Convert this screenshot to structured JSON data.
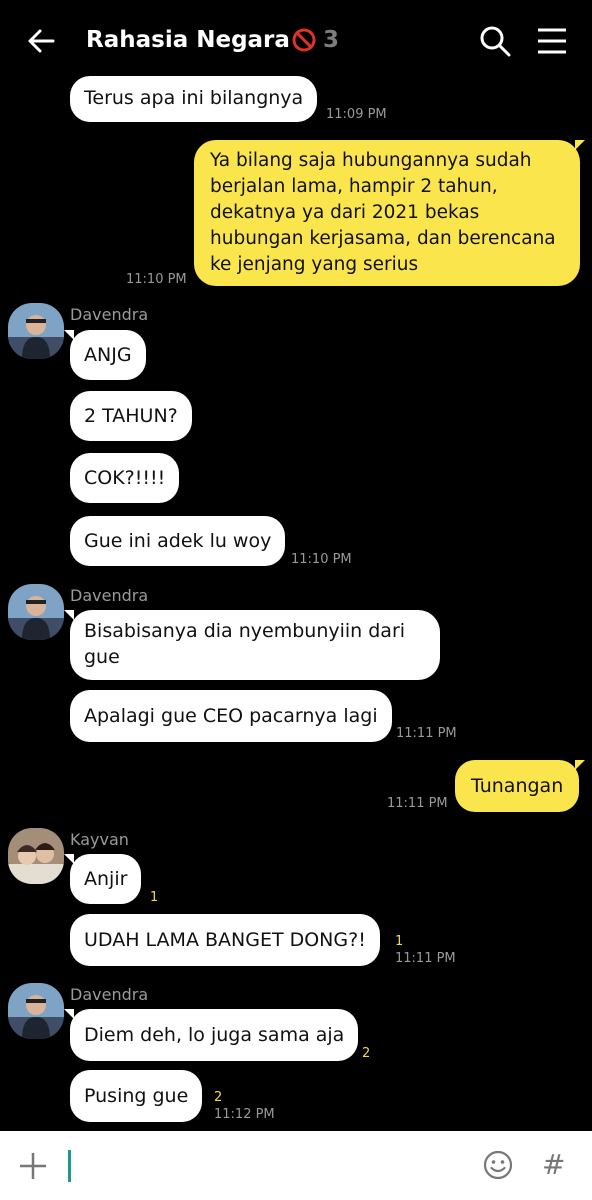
{
  "header": {
    "title": "Rahasia Negara",
    "member_count": "3"
  },
  "messages": [
    {
      "dir": "in",
      "text": "Terus apa ini bilangnya",
      "time": "11:09 PM"
    },
    {
      "dir": "out",
      "text": "Ya bilang saja hubungannya sudah berjalan lama, hampir 2 tahun, dekatnya ya dari 2021 bekas hubungan kerjasama, dan berencana ke jenjang yang serius",
      "time": "11:10 PM"
    },
    {
      "dir": "in",
      "sender": "Davendra",
      "text": "ANJG"
    },
    {
      "dir": "in",
      "text": "2 TAHUN?"
    },
    {
      "dir": "in",
      "text": "COK?!!!!"
    },
    {
      "dir": "in",
      "text": "Gue ini adek lu woy",
      "time": "11:10 PM"
    },
    {
      "dir": "in",
      "sender": "Davendra",
      "text": "Bisabisanya dia nyembunyiin dari gue"
    },
    {
      "dir": "in",
      "text": "Apalagi gue CEO pacarnya lagi",
      "time": "11:11 PM"
    },
    {
      "dir": "out",
      "text": "Tunangan",
      "time": "11:11 PM"
    },
    {
      "dir": "in",
      "sender": "Kayvan",
      "text": "Anjir",
      "unread": "1"
    },
    {
      "dir": "in",
      "text": "UDAH LAMA BANGET DONG?!",
      "unread": "1",
      "time": "11:11 PM"
    },
    {
      "dir": "in",
      "sender": "Davendra",
      "text": "Diem deh, lo juga sama aja",
      "unread": "2"
    },
    {
      "dir": "in",
      "text": "Pusing gue",
      "unread": "2",
      "time": "11:12 PM"
    }
  ],
  "composer": {
    "plus_icon": "plus-icon",
    "emoji_icon": "emoji-icon",
    "hash_label": "#"
  },
  "colors": {
    "background": "#000000",
    "outgoing_bubble": "#fbe54d",
    "incoming_bubble": "#ffffff",
    "unread": "#f5d84a"
  }
}
